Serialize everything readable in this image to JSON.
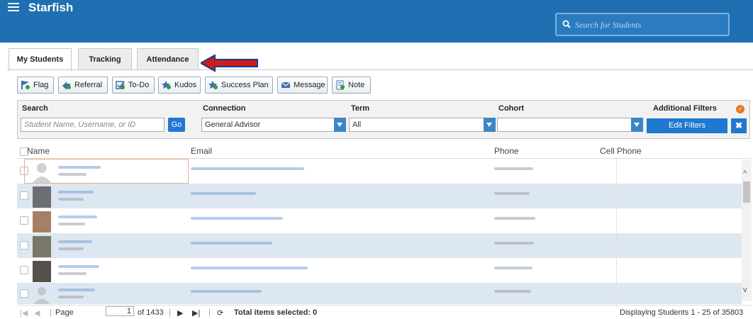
{
  "header": {
    "app_title": "Starfish",
    "search_placeholder": "Search for Students"
  },
  "tabs": [
    {
      "label": "My Students",
      "active": true
    },
    {
      "label": "Tracking",
      "active": false
    },
    {
      "label": "Attendance",
      "active": false
    }
  ],
  "toolbar": {
    "buttons": [
      "Flag",
      "Referral",
      "To-Do",
      "Kudos",
      "Success Plan",
      "Message",
      "Note"
    ]
  },
  "filters": {
    "search_label": "Search",
    "search_placeholder": "Student Name, Username, or ID",
    "go_label": "Go",
    "connection_label": "Connection",
    "connection_value": "General Advisor",
    "term_label": "Term",
    "term_value": "All",
    "cohort_label": "Cohort",
    "cohort_value": "",
    "additional_label": "Additional Filters",
    "edit_label": "Edit Filters",
    "clear_label": "✖"
  },
  "table": {
    "columns": [
      "Name",
      "Email",
      "Phone",
      "Cell Phone"
    ],
    "row_count_visible": 6
  },
  "pager": {
    "page_label": "Page",
    "page_value": "1",
    "of_label": "of 1433",
    "selected_label": "Total items selected: 0",
    "displaying": "Displaying Students 1 - 25 of 35803"
  },
  "colors": {
    "header": "#1f6fb2",
    "accent": "#1f78d1",
    "row_alt": "#dde7f1",
    "arrow": "#c81e1e"
  }
}
